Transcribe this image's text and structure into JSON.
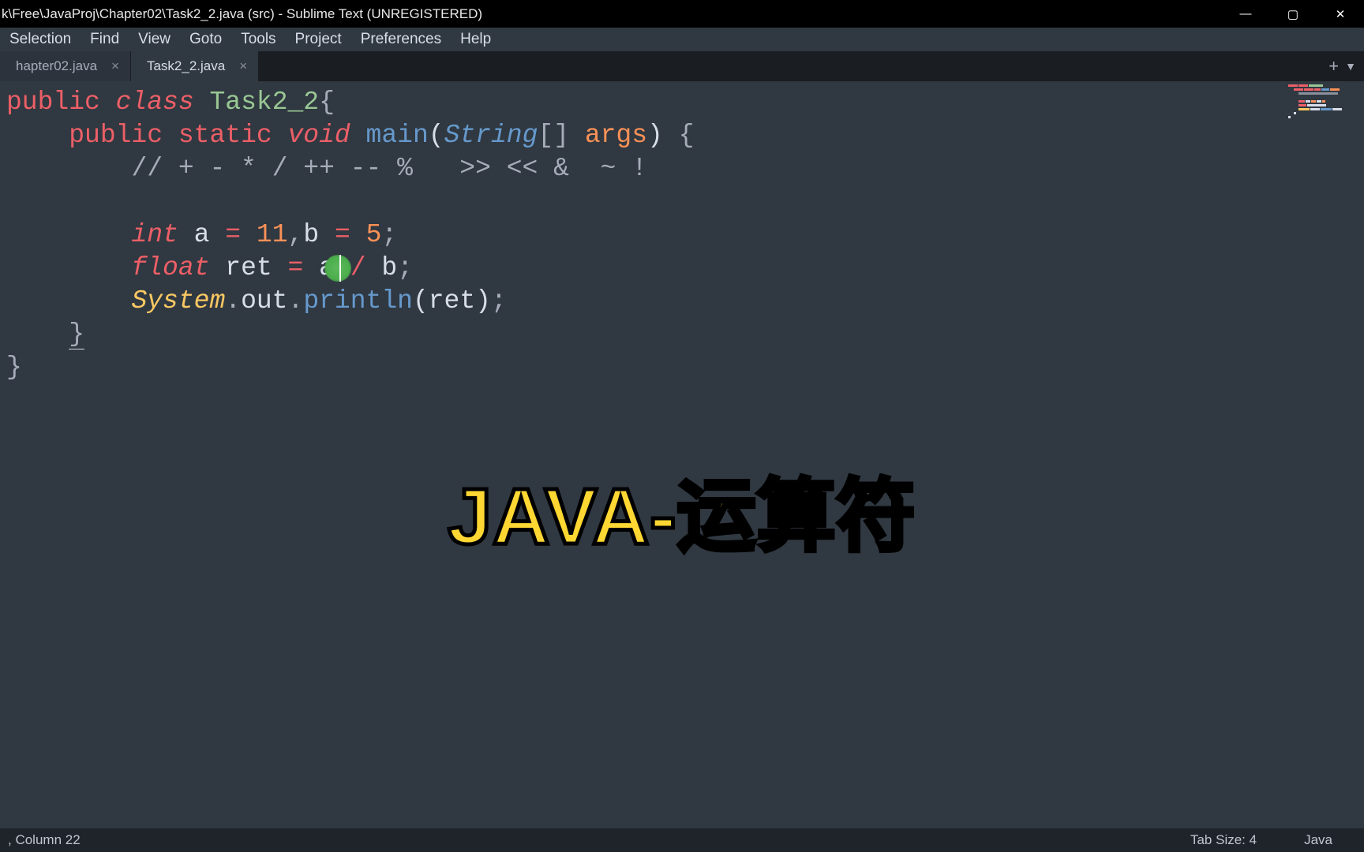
{
  "window": {
    "title": "k\\Free\\JavaProj\\Chapter02\\Task2_2.java (src) - Sublime Text (UNREGISTERED)"
  },
  "menu": [
    "Selection",
    "Find",
    "View",
    "Goto",
    "Tools",
    "Project",
    "Preferences",
    "Help"
  ],
  "tabs": [
    {
      "label": "hapter02.java",
      "active": false
    },
    {
      "label": "Task2_2.java",
      "active": true
    }
  ],
  "code": {
    "l1": {
      "public": "public",
      "class": "class",
      "name": "Task2_2",
      "brace": "{"
    },
    "l2": {
      "public": "public",
      "static": "static",
      "void": "void",
      "main": "main",
      "lp": "(",
      "String": "String",
      "brackets": "[]",
      "args": "args",
      "rp": ")",
      "brace": "{"
    },
    "l3": {
      "comment": "// + - * / ++ -- %   >> << &  ~ !"
    },
    "l4": {
      "int": "int",
      "a": "a",
      "eq1": "=",
      "v1": "11",
      "comma": ",",
      "b": "b",
      "eq2": "=",
      "v2": "5",
      "semi": ";"
    },
    "l5": {
      "float": "float",
      "ret": "ret",
      "eq": "=",
      "a": "a",
      "slash": "/",
      "b": "b",
      "semi": ";"
    },
    "l6": {
      "System": "System",
      "dot1": ".",
      "out": "out",
      "dot2": ".",
      "println": "println",
      "lp": "(",
      "arg": "ret",
      "rp": ")",
      "semi": ";"
    },
    "l7": {
      "brace": "}"
    },
    "l8": {
      "brace": "}"
    }
  },
  "overlay": "JAVA-运算符",
  "status": {
    "left": ", Column 22",
    "tabsize": "Tab Size: 4",
    "lang": "Java"
  },
  "icons": {
    "minimize": "—",
    "maximize": "▢",
    "close": "✕",
    "plus": "+",
    "dropdown": "▼",
    "tab_close": "×"
  }
}
